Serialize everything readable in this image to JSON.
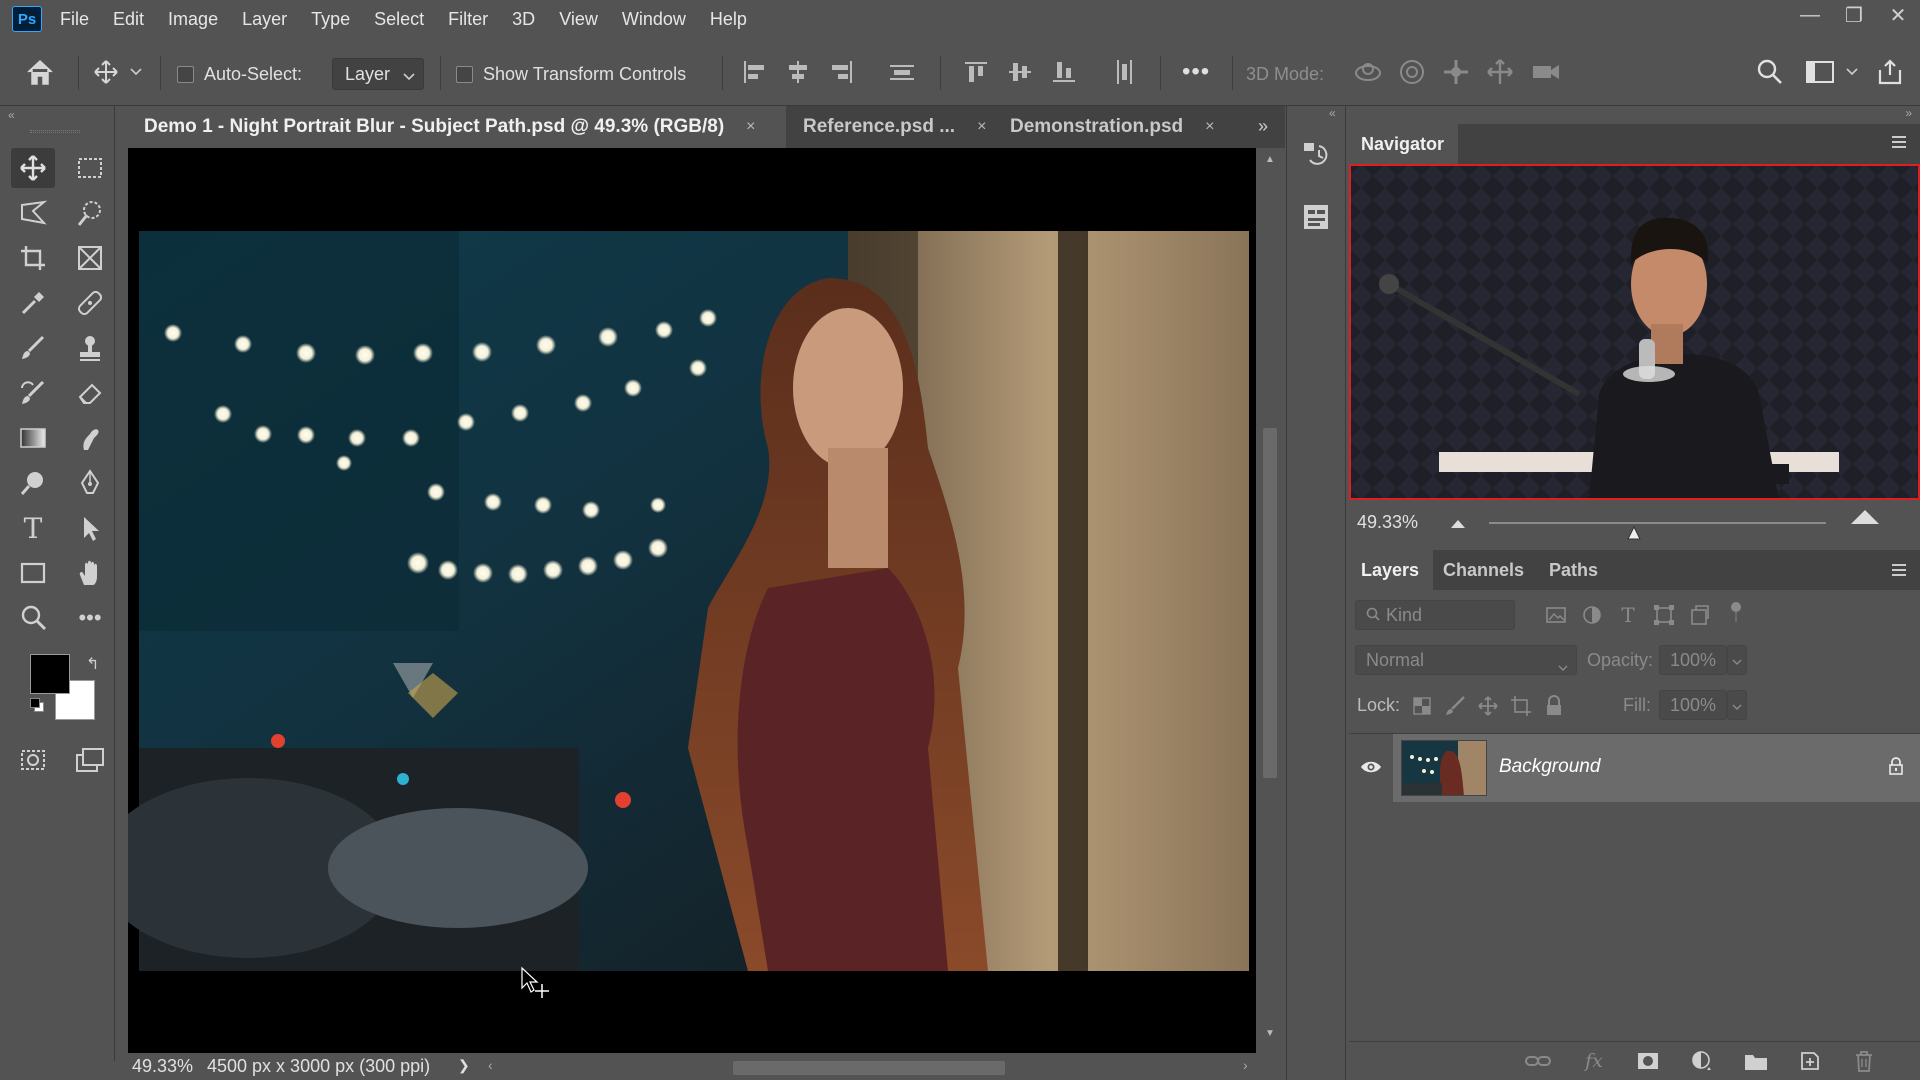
{
  "app": {
    "logo_text": "Ps"
  },
  "menu": [
    "File",
    "Edit",
    "Image",
    "Layer",
    "Type",
    "Select",
    "Filter",
    "3D",
    "View",
    "Window",
    "Help"
  ],
  "window_controls": {
    "minimize": "—",
    "restore": "❐",
    "close": "✕"
  },
  "options": {
    "auto_select_label": "Auto-Select:",
    "auto_select_target": "Layer",
    "show_transform_label": "Show Transform Controls",
    "more": "•••",
    "three_d_mode_label": "3D Mode:"
  },
  "tabs": [
    {
      "label": "Demo 1 - Night Portrait Blur - Subject Path.psd @ 49.3% (RGB/8)",
      "active": true
    },
    {
      "label": "Reference.psd ...",
      "active": false
    },
    {
      "label": "Demonstration.psd",
      "active": false
    }
  ],
  "tab_close_glyph": "×",
  "status": {
    "zoom": "49.33%",
    "doc_info": "4500 px x 3000 px (300 ppi)",
    "arrow": "❯"
  },
  "navigator": {
    "title": "Navigator",
    "zoom": "49.33%",
    "zoom_slider_fraction": 0.43
  },
  "layers_panel": {
    "tabs": [
      "Layers",
      "Channels",
      "Paths"
    ],
    "filter_placeholder": "Kind",
    "blend_mode": "Normal",
    "opacity_label": "Opacity:",
    "opacity_value": "100%",
    "lock_label": "Lock:",
    "fill_label": "Fill:",
    "fill_value": "100%",
    "layers": [
      {
        "name": "Background",
        "visible": true,
        "locked": true
      }
    ]
  },
  "tools": [
    "move-tool",
    "marquee-tool",
    "lasso-tool",
    "quick-select-tool",
    "crop-tool",
    "frame-tool",
    "eyedropper-tool",
    "healing-tool",
    "brush-tool",
    "stamp-tool",
    "history-brush-tool",
    "eraser-tool",
    "gradient-tool",
    "smudge-tool",
    "dodge-tool",
    "pen-tool",
    "type-tool",
    "path-select-tool",
    "rectangle-tool",
    "hand-tool",
    "zoom-tool",
    "more-tools"
  ],
  "tool_more_glyph": "•••",
  "type_tool_glyph": "T",
  "colors": {
    "foreground": "#000000",
    "background": "#ffffff",
    "accent": "#31a8ff"
  }
}
